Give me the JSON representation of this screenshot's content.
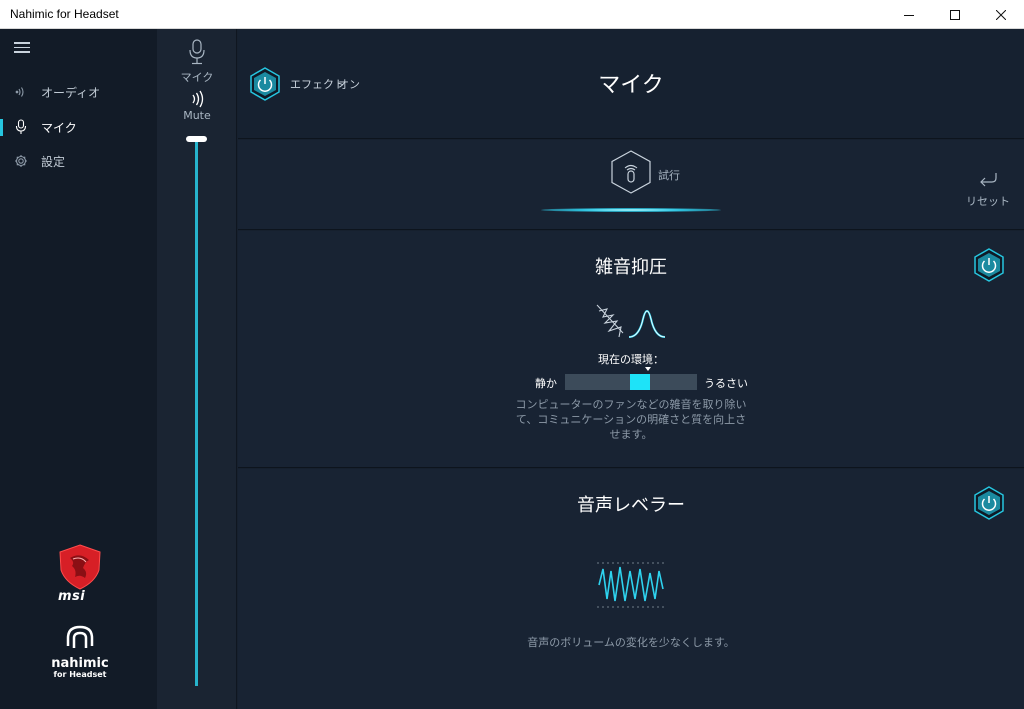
{
  "window": {
    "title": "Nahimic for Headset"
  },
  "sidebar": {
    "items": [
      {
        "label": "オーディオ",
        "icon": "audio-waves-icon"
      },
      {
        "label": "マイク",
        "icon": "microphone-icon",
        "active": true
      },
      {
        "label": "設定",
        "icon": "gear-icon"
      }
    ],
    "brand_msi": "msi",
    "brand_nahimic": "nahimic",
    "brand_nahimic_sub": "for Headset"
  },
  "device": {
    "mic_label": "マイク",
    "mute_label": "Mute",
    "volume": 1.0
  },
  "header": {
    "effect_label": "エフェクト",
    "effect_state": "オン",
    "title": "マイク"
  },
  "test": {
    "label": "試行",
    "reset_label": "リセット"
  },
  "noise_reduction": {
    "title": "雑音抑圧",
    "env_label": "現在の環境：",
    "low_label": "静か",
    "high_label": "うるさい",
    "level": 0.55,
    "desc_lines": [
      "コンピューターのファンなどの雑音を取り除い",
      "て、コミュニケーションの明確さと質を向上さ",
      "せます。"
    ]
  },
  "voice_leveler": {
    "title": "音声レベラー",
    "desc": "音声のボリュームの変化を少なくします。"
  },
  "colors": {
    "accent": "#26c6e0",
    "slider_handle": "#1ee3f8",
    "background": "#16202e",
    "sidebar": "#121b27"
  }
}
